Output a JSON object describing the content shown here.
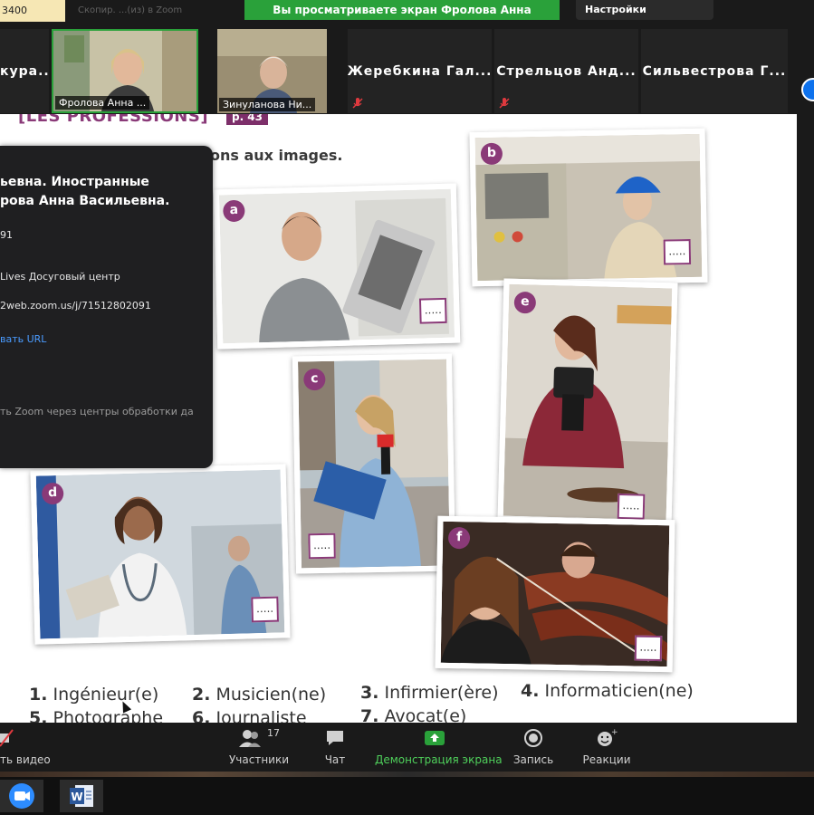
{
  "top": {
    "meeting_id_fragment": "3400",
    "url_ghost": "Скопир. ...(из) в Zoom",
    "share_banner": "Вы просматриваете экран Фролова Анна Васильевна",
    "view_settings": "Настройки просмотра"
  },
  "gallery": {
    "tiles": [
      {
        "type": "name",
        "label": "кура..."
      },
      {
        "type": "video",
        "caption": "Фролова Анна ..."
      },
      {
        "type": "video",
        "caption": "Зинуланова Ни..."
      },
      {
        "type": "name",
        "label": "Жеребкина Гал...",
        "muted": true
      },
      {
        "type": "name",
        "label": "Стрельцов Анд...",
        "muted": true
      },
      {
        "type": "name",
        "label": "Сильвестрова Г..."
      }
    ]
  },
  "popup": {
    "title_line1": "ьевна. Иностранные",
    "title_line2": "рова Анна Васильевна.",
    "id_fragment": "91",
    "org": "Lives Досуговый центр",
    "join_url": "2web.zoom.us/j/71512802091",
    "copy_url": "вать URL",
    "notice": "ть Zoom через центры обработки да"
  },
  "textbook": {
    "header": "[LES PROFESSIONS]",
    "page": "p. 43",
    "instruction": "ons aux images.",
    "photos": [
      {
        "letter": "a",
        "answer": "....."
      },
      {
        "letter": "b",
        "answer": "....."
      },
      {
        "letter": "c",
        "answer": "....."
      },
      {
        "letter": "d",
        "answer": "....."
      },
      {
        "letter": "e",
        "answer": "....."
      },
      {
        "letter": "f",
        "answer": "....."
      }
    ],
    "words": [
      {
        "num": "1.",
        "word": "Ingénieur(e)"
      },
      {
        "num": "2.",
        "word": "Musicien(ne)"
      },
      {
        "num": "3.",
        "word": "Infirmier(ère)"
      },
      {
        "num": "4.",
        "word": "Informaticien(ne)"
      },
      {
        "num": "5.",
        "word": "Photographe"
      },
      {
        "num": "6.",
        "word": "Journaliste"
      },
      {
        "num": "7.",
        "word": "Avocat(e)"
      }
    ]
  },
  "toolbar": {
    "video_label": "ть видео",
    "participants_label": "Участники",
    "participants_count": "17",
    "chat_label": "Чат",
    "share_label": "Демонстрация экрана",
    "record_label": "Запись",
    "reactions_label": "Реакции"
  },
  "colors": {
    "share_green": "#2aa13a",
    "textbook_purple": "#8a3a78",
    "zoom_blue": "#0e72ed"
  }
}
